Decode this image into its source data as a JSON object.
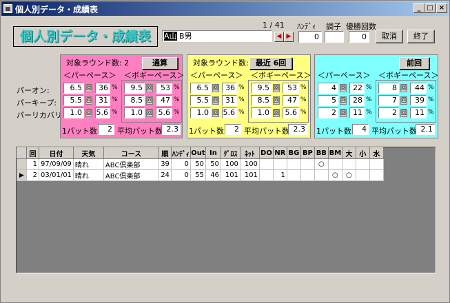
{
  "window": {
    "title": "個人別データ・成績表",
    "icon": "form-icon"
  },
  "form": {
    "big_title": "個人別データ・成績表",
    "record_pos": "1 / 41",
    "player_name_prefix": "A山",
    "player_name_suffix": " B男",
    "labels": {
      "handicap": "ﾊﾝﾃﾞｨ",
      "condition": "調子",
      "wins": "優勝回数"
    },
    "handicap": "0",
    "condition": "",
    "wins": "0",
    "cancel_label": "取消",
    "close_label": "終了"
  },
  "row_labels": {
    "par_on": "パーオン:",
    "par_keep": "パーキープ:",
    "par_recovery": "パーリカバリ:"
  },
  "panels": [
    {
      "color": "#ff80c0",
      "rounds_label": "対象ラウンド数:",
      "rounds": "2",
      "button": "通算",
      "par_hdr": "＜パーペース＞",
      "bogey_hdr": "＜ボギーペース＞",
      "par_rows": [
        [
          "6.5",
          "36"
        ],
        [
          "5.5",
          "31"
        ],
        [
          "1.0",
          "5.6"
        ]
      ],
      "bogey_rows": [
        [
          "9.5",
          "53"
        ],
        [
          "8.5",
          "47"
        ],
        [
          "1.0",
          "5.6"
        ]
      ],
      "putt1_label": "1パット数:",
      "putt1": "2",
      "avg_label": "平均パット数:",
      "avg": "2.3"
    },
    {
      "color": "#ffff80",
      "rounds_label": "対象ラウンド数:",
      "rounds": "2",
      "button": "最近 6回",
      "par_hdr": "＜パーペース＞",
      "bogey_hdr": "＜ボギーペース＞",
      "par_rows": [
        [
          "6.5",
          "36"
        ],
        [
          "5.5",
          "31"
        ],
        [
          "1.0",
          "5.6"
        ]
      ],
      "bogey_rows": [
        [
          "9.5",
          "53"
        ],
        [
          "8.5",
          "47"
        ],
        [
          "1.0",
          "5.6"
        ]
      ],
      "putt1_label": "1パット数:",
      "putt1": "2",
      "avg_label": "平均パット数:",
      "avg": "2.3"
    },
    {
      "color": "#80ffff",
      "rounds_label": "",
      "rounds": "",
      "button": "前回",
      "par_hdr": "＜パーペース＞",
      "bogey_hdr": "＜ボギーペース＞",
      "par_rows": [
        [
          "4",
          "22"
        ],
        [
          "5",
          "28"
        ],
        [
          "2",
          "11"
        ]
      ],
      "bogey_rows": [
        [
          "8",
          "44"
        ],
        [
          "7",
          "39"
        ],
        [
          "2",
          "11"
        ]
      ],
      "putt1_label": "1パット数:",
      "putt1": "4",
      "avg_label": "平均パット数:",
      "avg": "2.1"
    }
  ],
  "unit_kai": "回",
  "unit_pct": "%",
  "table": {
    "columns": [
      "",
      "回",
      "日付",
      "天気",
      "コース",
      "順",
      "ﾊﾝﾃﾞｨ",
      "Out",
      "In",
      "ｸﾞﾛｽ",
      "ﾈｯﾄ",
      "DO",
      "NR",
      "BG",
      "BP",
      "BB",
      "BM",
      "大",
      "小",
      "水"
    ],
    "rows": [
      [
        "",
        "1",
        "97/09/09",
        "晴れ",
        "ABC倶楽部",
        "39",
        "0",
        "50",
        "50",
        "100",
        "100",
        "",
        "",
        "",
        "",
        "○",
        "",
        "",
        "",
        ""
      ],
      [
        "▶",
        "2",
        "03/01/01",
        "晴れ",
        "ABC倶楽部",
        "24",
        "0",
        "55",
        "46",
        "101",
        "101",
        "",
        "1",
        "",
        "",
        "",
        "○",
        "○",
        "",
        ""
      ]
    ]
  }
}
